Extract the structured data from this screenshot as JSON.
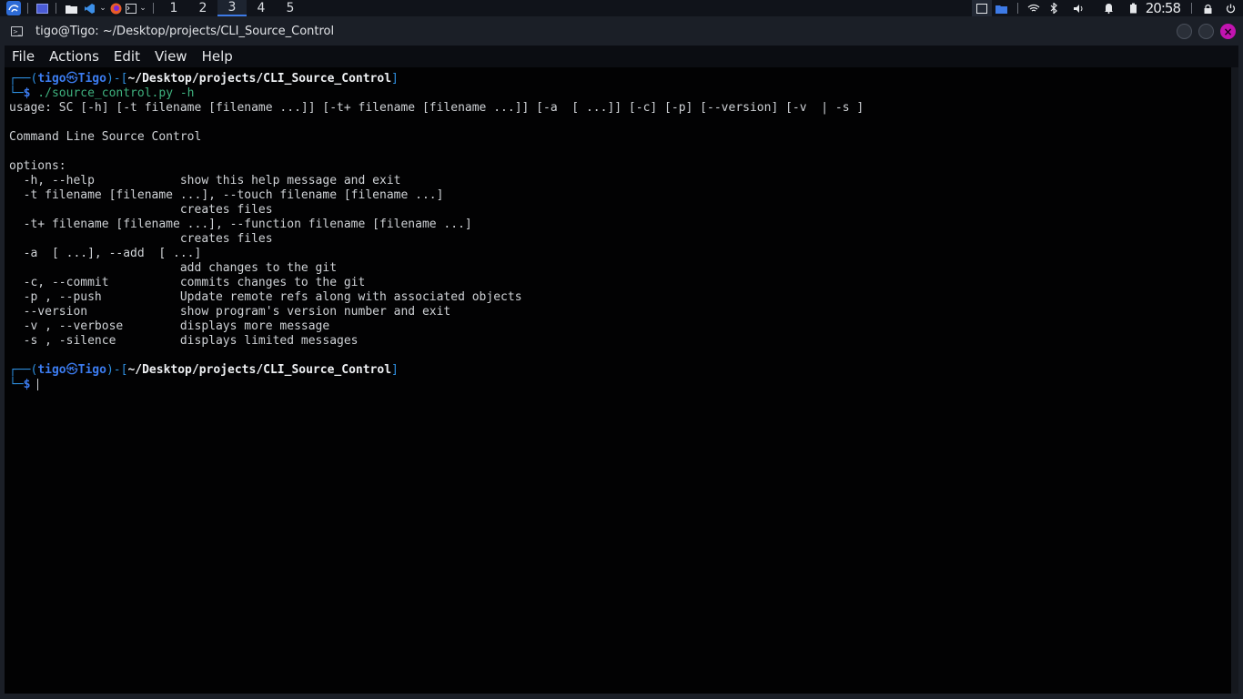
{
  "panel": {
    "workspaces": [
      "1",
      "2",
      "3",
      "4",
      "5"
    ],
    "active_workspace": "3",
    "clock": "20:58"
  },
  "window": {
    "title": "tigo@Tigo: ~/Desktop/projects/CLI_Source_Control"
  },
  "menu": {
    "file": "File",
    "actions": "Actions",
    "edit": "Edit",
    "view": "View",
    "help": "Help"
  },
  "terminal": {
    "prompt1": {
      "box_top": "┌──(",
      "user": "tigo",
      "at": "㉿",
      "host": "Tigo",
      "mid": ")-[",
      "dir": "~/Desktop/projects/CLI_Source_Control",
      "end": "]",
      "box_bottom": "└─",
      "dollar": "$",
      "command": " ./source_control.py",
      "args": " -h"
    },
    "output": [
      "usage: SC [-h] [-t filename [filename ...]] [-t+ filename [filename ...]] [-a  [ ...]] [-c] [-p] [--version] [-v  | -s ]",
      "",
      "Command Line Source Control",
      "",
      "options:",
      "  -h, --help            show this help message and exit",
      "  -t filename [filename ...], --touch filename [filename ...]",
      "                        creates files",
      "  -t+ filename [filename ...], --function filename [filename ...]",
      "                        creates files",
      "  -a  [ ...], --add  [ ...]",
      "                        add changes to the git",
      "  -c, --commit          commits changes to the git",
      "  -p , --push           Update remote refs along with associated objects",
      "  --version             show program's version number and exit",
      "  -v , --verbose        displays more message",
      "  -s , -silence         displays limited messages"
    ],
    "prompt2": {
      "box_top": "┌──(",
      "user": "tigo",
      "at": "㉿",
      "host": "Tigo",
      "mid": ")-[",
      "dir": "~/Desktop/projects/CLI_Source_Control",
      "end": "]",
      "box_bottom": "└─",
      "dollar": "$"
    }
  },
  "colors": {
    "prompt_blue": "#3c7cf0",
    "command_green": "#3fb27f",
    "close_button": "#c214b0",
    "active_workspace_underline": "#3d7ae6"
  }
}
